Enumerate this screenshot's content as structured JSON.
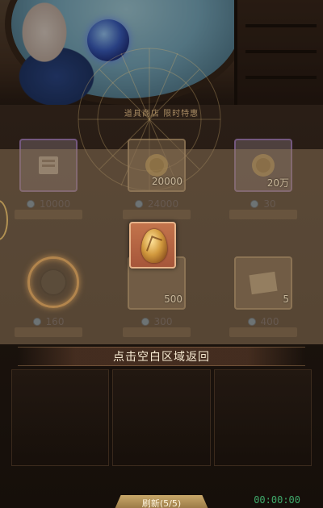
{
  "scene": {
    "orb_color": "#3f63c8"
  },
  "board": {
    "title": "道具商店 限时特惠"
  },
  "items": [
    {
      "name": "scroll-item",
      "icon": "scroll-icon",
      "slot": "purple",
      "quantity": "",
      "price": "10000"
    },
    {
      "name": "gold-coin-item",
      "icon": "coin-icon",
      "slot": "normal",
      "quantity": "20000",
      "price": "24000"
    },
    {
      "name": "gold-coin-item",
      "icon": "coin-icon",
      "slot": "purple",
      "quantity": "20万",
      "price": "30"
    },
    {
      "name": "ring-item",
      "icon": "ring-icon",
      "slot": "none",
      "quantity": "",
      "price": "160"
    },
    {
      "name": "stone-item",
      "icon": "stone-icon",
      "slot": "normal",
      "quantity": "500",
      "price": "300"
    },
    {
      "name": "map-item",
      "icon": "map-icon",
      "slot": "normal",
      "quantity": "5",
      "price": "400"
    }
  ],
  "hint": {
    "text": "点击空白区域返回"
  },
  "footer": {
    "refresh_label": "刷新(5/5)",
    "timer": "00:00:00"
  },
  "colors": {
    "accent": "#c98a3e",
    "focus_bg": "#b0613f",
    "timer": "#3fa86a"
  }
}
